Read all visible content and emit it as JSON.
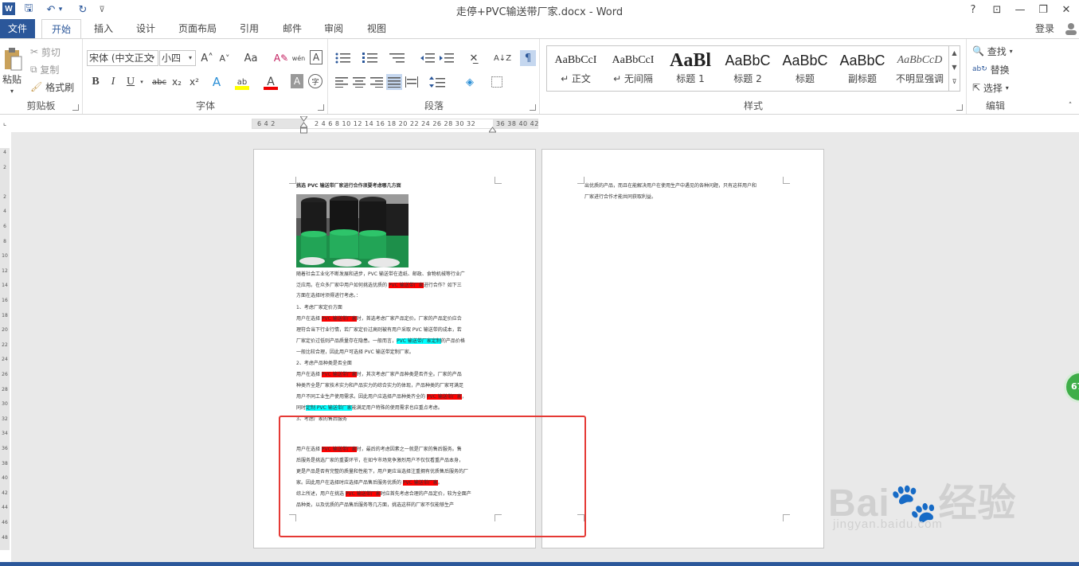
{
  "titlebar": {
    "title": "走停+PVC输送带厂家.docx - Word",
    "help": "?",
    "ribbon_display": "⊡",
    "minimize": "—",
    "restore": "❐",
    "close": "✕"
  },
  "quick_access": {
    "app_icon": "W",
    "save": "🖫",
    "undo": "↶",
    "undo_dd": "▾",
    "redo": "↻",
    "customize": "⊽"
  },
  "tabs": [
    {
      "label": "文件"
    },
    {
      "label": "开始"
    },
    {
      "label": "插入"
    },
    {
      "label": "设计"
    },
    {
      "label": "页面布局"
    },
    {
      "label": "引用"
    },
    {
      "label": "邮件"
    },
    {
      "label": "审阅"
    },
    {
      "label": "视图"
    }
  ],
  "signin": "登录",
  "clipboard": {
    "paste": "粘贴",
    "cut": "剪切",
    "copy": "复制",
    "format_painter": "格式刷",
    "label": "剪贴板"
  },
  "font": {
    "font_name": "宋体 (中文正文",
    "font_size": "小四",
    "grow": "A˄",
    "shrink": "A˅",
    "change_case": "Aa",
    "clear_format": "A✎",
    "phonetic": "wén",
    "border_char": "A",
    "bold": "B",
    "italic": "I",
    "underline": "U",
    "strike": "abc",
    "subscript": "x₂",
    "superscript": "x²",
    "effects": "A",
    "highlight": "ab",
    "font_color": "A",
    "shading": "A",
    "enclose": "字",
    "label": "字体"
  },
  "paragraph": {
    "label": "段落"
  },
  "styles": {
    "items": [
      {
        "preview": "AaBbCcI",
        "name": "↵ 正文"
      },
      {
        "preview": "AaBbCcI",
        "name": "↵ 无间隔"
      },
      {
        "preview": "AaBl",
        "name": "标题 1"
      },
      {
        "preview": "AaBbC",
        "name": "标题 2"
      },
      {
        "preview": "AaBbC",
        "name": "标题"
      },
      {
        "preview": "AaBbC",
        "name": "副标题"
      },
      {
        "preview": "AaBbCcD",
        "name": "不明显强调"
      }
    ],
    "label": "样式"
  },
  "editing": {
    "find": "查找",
    "replace": "替换",
    "select": "选择",
    "label": "编辑"
  },
  "ruler": {
    "left_nums": "6  4  2",
    "mid_nums": "2  4  6  8  10 12 14 16 18 20 22 24 26 28 30 32",
    "right_nums": "36 38 40 42"
  },
  "vruler_nums": [
    "4",
    "2",
    "",
    "2",
    "4",
    "6",
    "8",
    "10",
    "12",
    "14",
    "16",
    "18",
    "20",
    "22",
    "24",
    "26",
    "28",
    "30",
    "32",
    "34",
    "36",
    "38",
    "40",
    "42",
    "44",
    "46",
    "48"
  ],
  "page1": {
    "heading": "挑选 PVC 输送带厂家进行合作须要考虑哪几方面",
    "intro_a": "随着社会工业化不断发展和进步，PVC 输送带在造纸、邮政、食物机械等行业广",
    "intro_b1": "泛应用。在众多厂家中用户如何挑选优质的 ",
    "intro_hl": "PVC 输送带厂家",
    "intro_b2": "进行合作？如下三",
    "intro_c": "方面在选择时须得进行考虑。：",
    "s1_title": "1、考虑厂家定价方面",
    "s1_a1": "用户在选择 ",
    "s1_a_hl": "PVC 输送带厂家",
    "s1_a2": "时，首选考虑厂家产品定价。厂家的产品定价应合",
    "s1_b": "理符合当下行业行情，若厂家定价过高则被有用户采取 PVC 输送带的成本，若",
    "s1_c1": "厂家定价过低则产品质量存在隐患。一般而言，",
    "s1_c_hl": "PVC 输送带厂家定制",
    "s1_c2": "的产品价格",
    "s1_d": "一般比较合理，因此用户可选择 PVC 输送带定制厂家。",
    "s2_title": "2、考虑产品种类是否全面",
    "s2_a1": "用户在选择 ",
    "s2_a_hl": "PVC 输送带厂家",
    "s2_a2": "时，其次考虑厂家产品种类是否齐全。厂家的产品",
    "s2_b": "种类齐全是厂家技术实力和产品实力的综合实力的体现，产品种类的厂家可满足",
    "s2_c1": "用户不同工业生产使用需求。因此用户应选择产品种类齐全的 ",
    "s2_c_hl": "PVC 输送带厂家",
    "s2_c2": "，",
    "s2_d1": "同时",
    "s2_d_hl": "定制 PVC 输送带厂家",
    "s2_d2": "能满足用户特殊的使用需求也应重点考虑。",
    "s3_title": "3、考虑厂家的售后服务",
    "s3_a1": "用户在选择 ",
    "s3_a_hl": "PVC 输送带厂家",
    "s3_a2": "时，最后的考虑因素之一就是厂家的售后服务。售",
    "s3_b": "后服务是挑选厂家的重要环节，在如今市场竞争激烈用户不仅仅看重产品本身，",
    "s3_c": "更是产品是否有完整的质量和性能下，用户更应当选择注重拥有优质售后服务的厂",
    "s3_d1": "家。因此用户在选择时应选择产品售后服务优质的 ",
    "s3_d_hl": "PVC 输送带厂家",
    "s3_d2": "。",
    "sum_a1": "综上所述，用户在挑选 ",
    "sum_a_hl": "PVC 输送带厂家",
    "sum_a2": "时应首先考虑合理的产品定价，较为全面产",
    "sum_b": "品种类，以及优质的产品售后服务等几方面，挑选这样的厂家不仅能够生产"
  },
  "page2": {
    "a": "出优质的产品，而且在能解决用户在使用生产中遇见的各种问题，只有这样用户和",
    "b": "厂家进行合作才能共同获取利益。"
  },
  "bubble": "67",
  "watermark": {
    "big": "Bai🐾经验",
    "small": "jingyan.baidu.com"
  }
}
